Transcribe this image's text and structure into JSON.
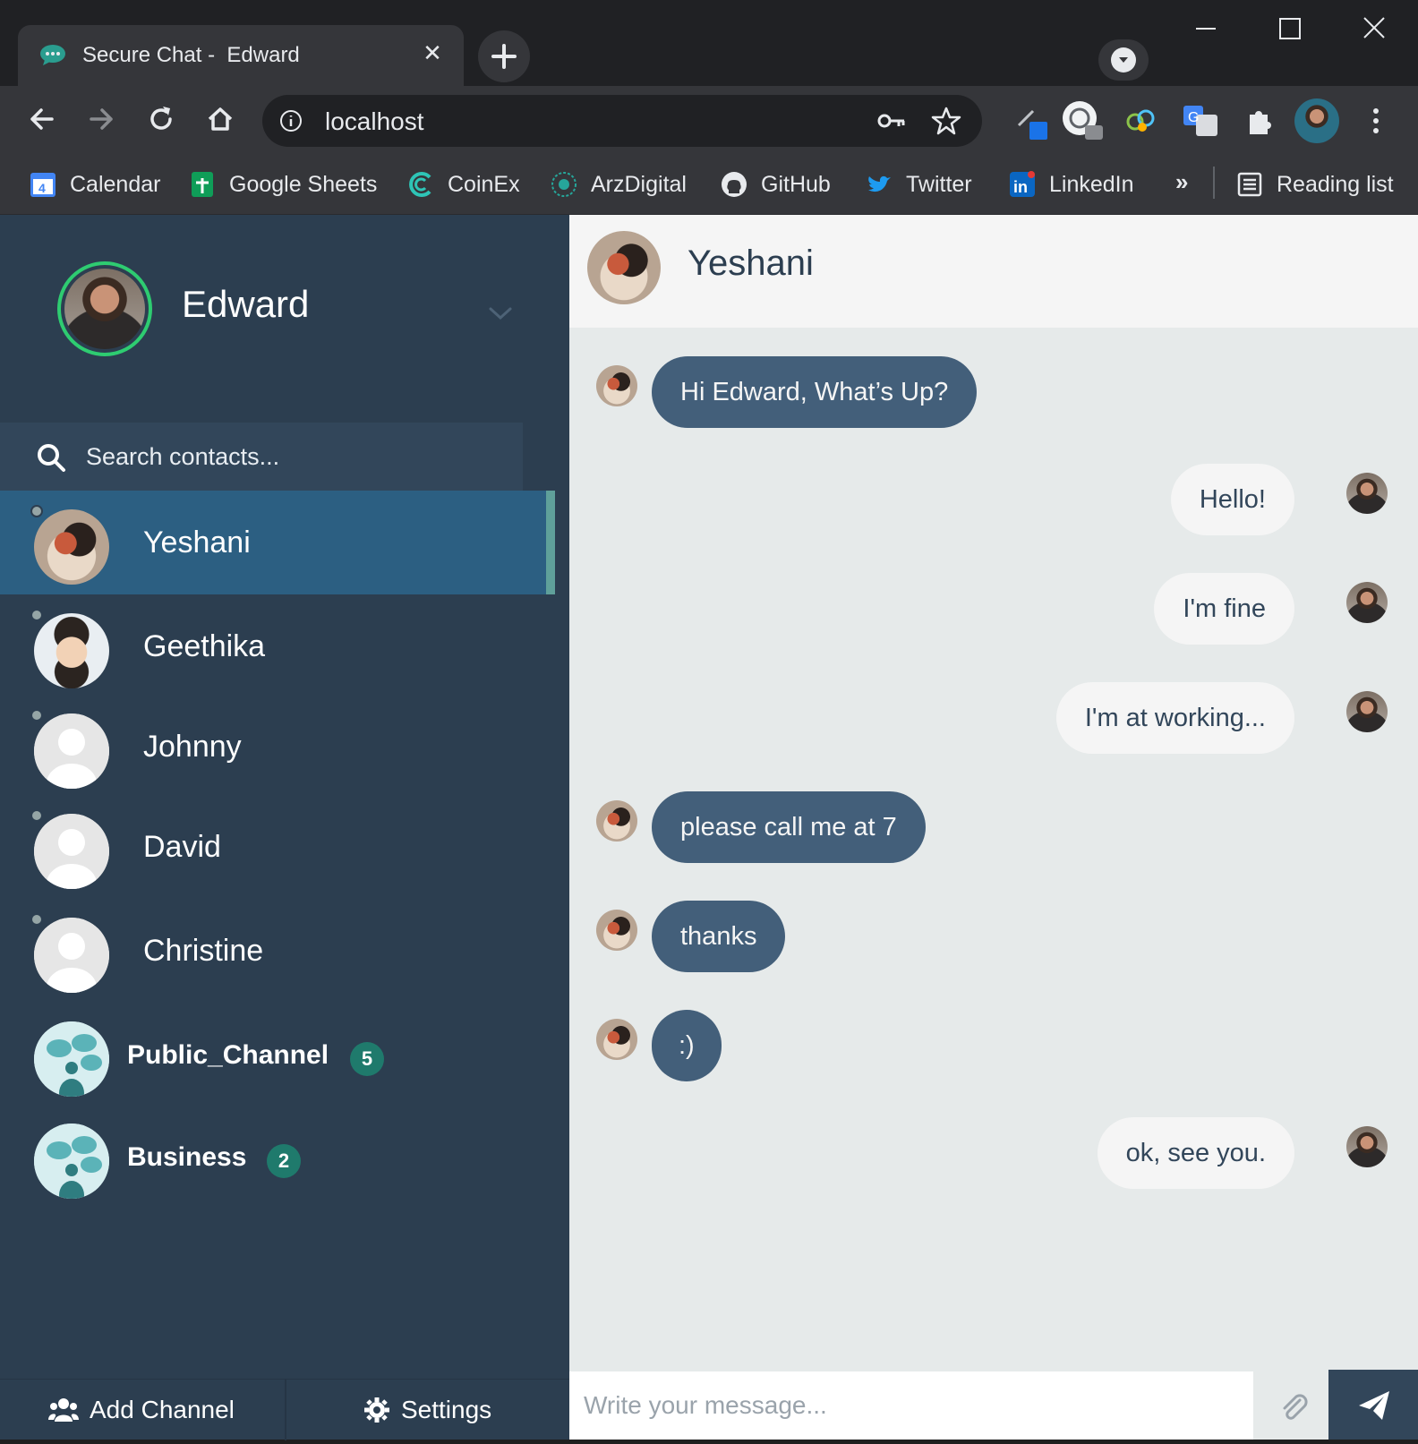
{
  "browser": {
    "tab_title": "Secure Chat -  Edward",
    "url": "localhost",
    "bookmarks": [
      {
        "label": "Calendar"
      },
      {
        "label": "Google Sheets"
      },
      {
        "label": "CoinEx"
      },
      {
        "label": "ArzDigital"
      },
      {
        "label": "GitHub"
      },
      {
        "label": "Twitter"
      },
      {
        "label": "LinkedIn"
      }
    ],
    "more_label": "»",
    "reading_list": "Reading list"
  },
  "profile": {
    "name": "Edward"
  },
  "search": {
    "placeholder": "Search contacts..."
  },
  "contacts": [
    {
      "name": "Yeshani",
      "active": true
    },
    {
      "name": "Geethika"
    },
    {
      "name": "Johnny"
    },
    {
      "name": "David"
    },
    {
      "name": "Christine"
    }
  ],
  "channels": [
    {
      "name": "Public_Channel",
      "badge": "5"
    },
    {
      "name": "Business",
      "badge": "2"
    }
  ],
  "footer": {
    "add_channel": "Add Channel",
    "settings": "Settings"
  },
  "chat": {
    "contact_name": "Yeshani",
    "messages": [
      {
        "dir": "in",
        "text": "Hi Edward, What’s Up?"
      },
      {
        "dir": "out",
        "text": "Hello!"
      },
      {
        "dir": "out",
        "text": "I'm fine"
      },
      {
        "dir": "out",
        "text": "I'm at working..."
      },
      {
        "dir": "in",
        "text": "please call me at 7"
      },
      {
        "dir": "in",
        "text": "thanks"
      },
      {
        "dir": "in",
        "text": ":)"
      },
      {
        "dir": "out",
        "text": "ok, see you."
      }
    ],
    "input_placeholder": "Write your message..."
  },
  "colors": {
    "sidebar": "#2c3e50",
    "active_contact": "#2c5f82",
    "incoming_bubble": "#435f7a",
    "outgoing_bubble": "#f5f5f5",
    "online_ring": "#2ecc71",
    "badge": "#1f7a6c"
  }
}
